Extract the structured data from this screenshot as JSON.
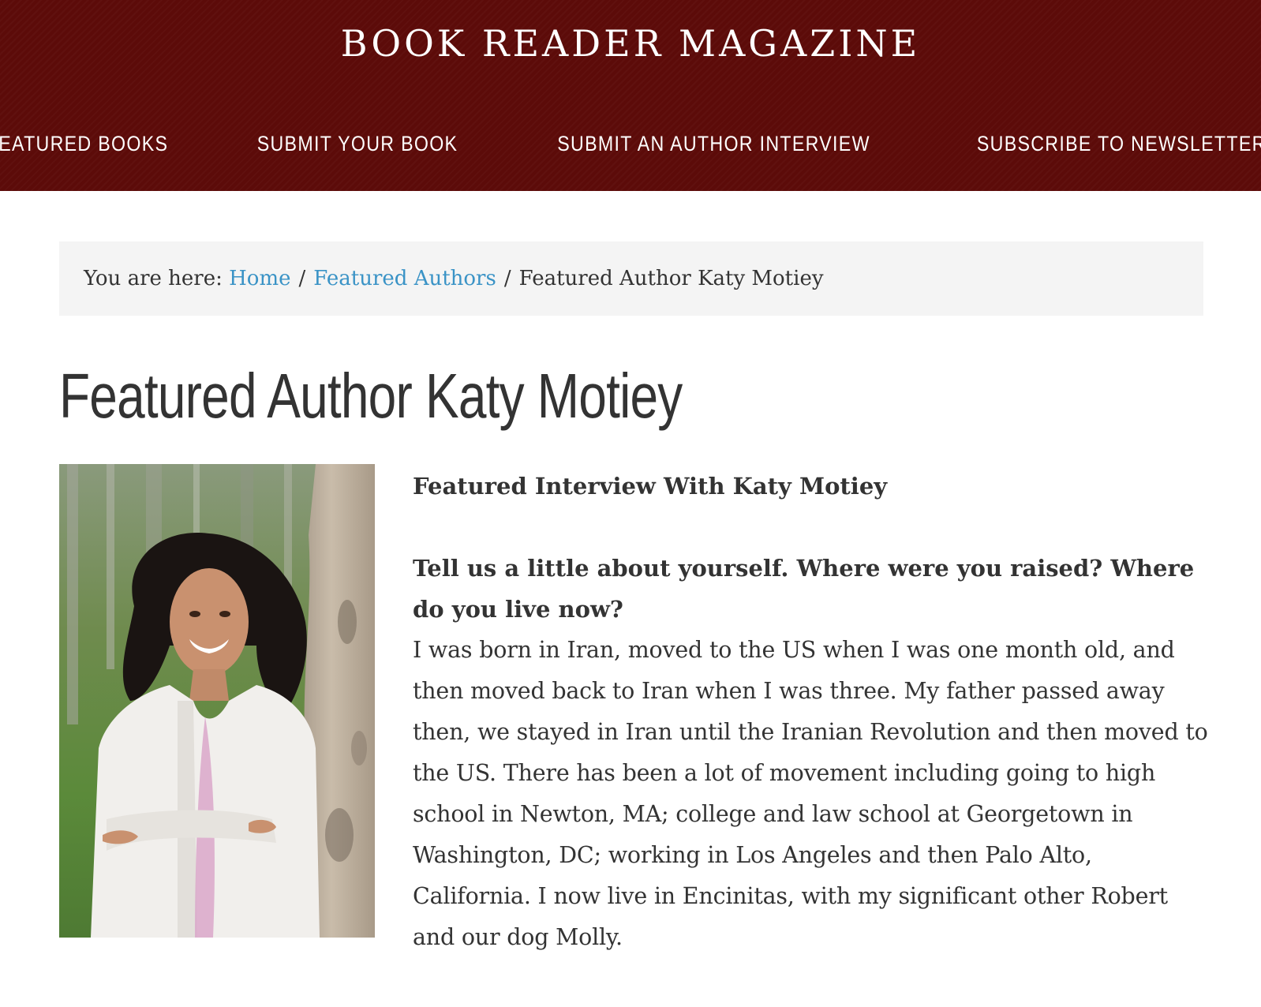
{
  "site": {
    "title": "BOOK READER MAGAZINE"
  },
  "nav": {
    "items": [
      {
        "label": "FEATURED BOOKS"
      },
      {
        "label": "SUBMIT YOUR BOOK"
      },
      {
        "label": "SUBMIT AN AUTHOR INTERVIEW"
      },
      {
        "label": "SUBSCRIBE TO NEWSLETTER"
      }
    ]
  },
  "breadcrumb": {
    "prefix": "You are here:",
    "home": "Home",
    "separator": "/",
    "section": "Featured Authors",
    "current": "Featured Author Katy Motiey"
  },
  "page": {
    "title": "Featured Author Katy Motiey"
  },
  "article": {
    "heading": "Featured Interview With Katy Motiey",
    "question": "Tell us a little about yourself. Where were you raised? Where do you live now?",
    "answer": "I was born in Iran, moved to the US when I was one month old, and then moved back to Iran when I was three. My father passed away then, we stayed in Iran until the Iranian Revolution and then moved to the US. There has been a lot of movement including going to high school in Newton, MA; college and law school at Georgetown in Washington, DC; working in Los Angeles and then Palo Alto, California. I now live in Encinitas, with my significant other Robert and our dog Molly."
  },
  "colors": {
    "header_bg": "#5c0b09",
    "link": "#3a93c6",
    "text": "#333333",
    "breadcrumb_bg": "#f4f4f4"
  }
}
